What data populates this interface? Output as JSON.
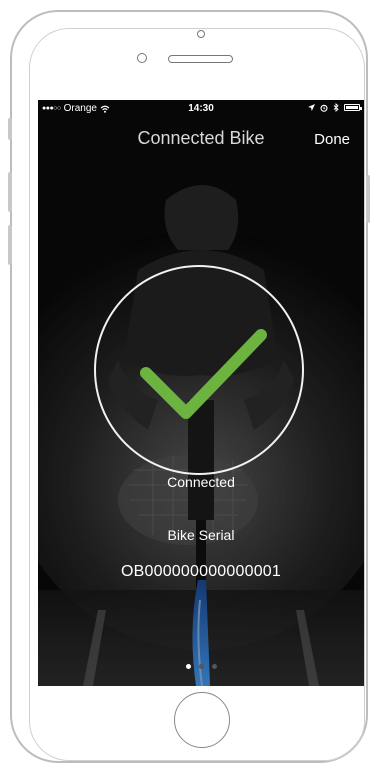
{
  "status_bar": {
    "signal": "●●●○○",
    "carrier": "Orange",
    "time": "14:30"
  },
  "navbar": {
    "title": "Connected Bike",
    "done_label": "Done"
  },
  "connection": {
    "status": "Connected",
    "serial_label": "Bike Serial",
    "serial_value": "OB000000000000001"
  },
  "pager": {
    "pages": 3,
    "current": 1
  },
  "colors": {
    "check": "#6cb33f",
    "screen_bg": "#0a0a0a",
    "text": "#ffffff"
  }
}
